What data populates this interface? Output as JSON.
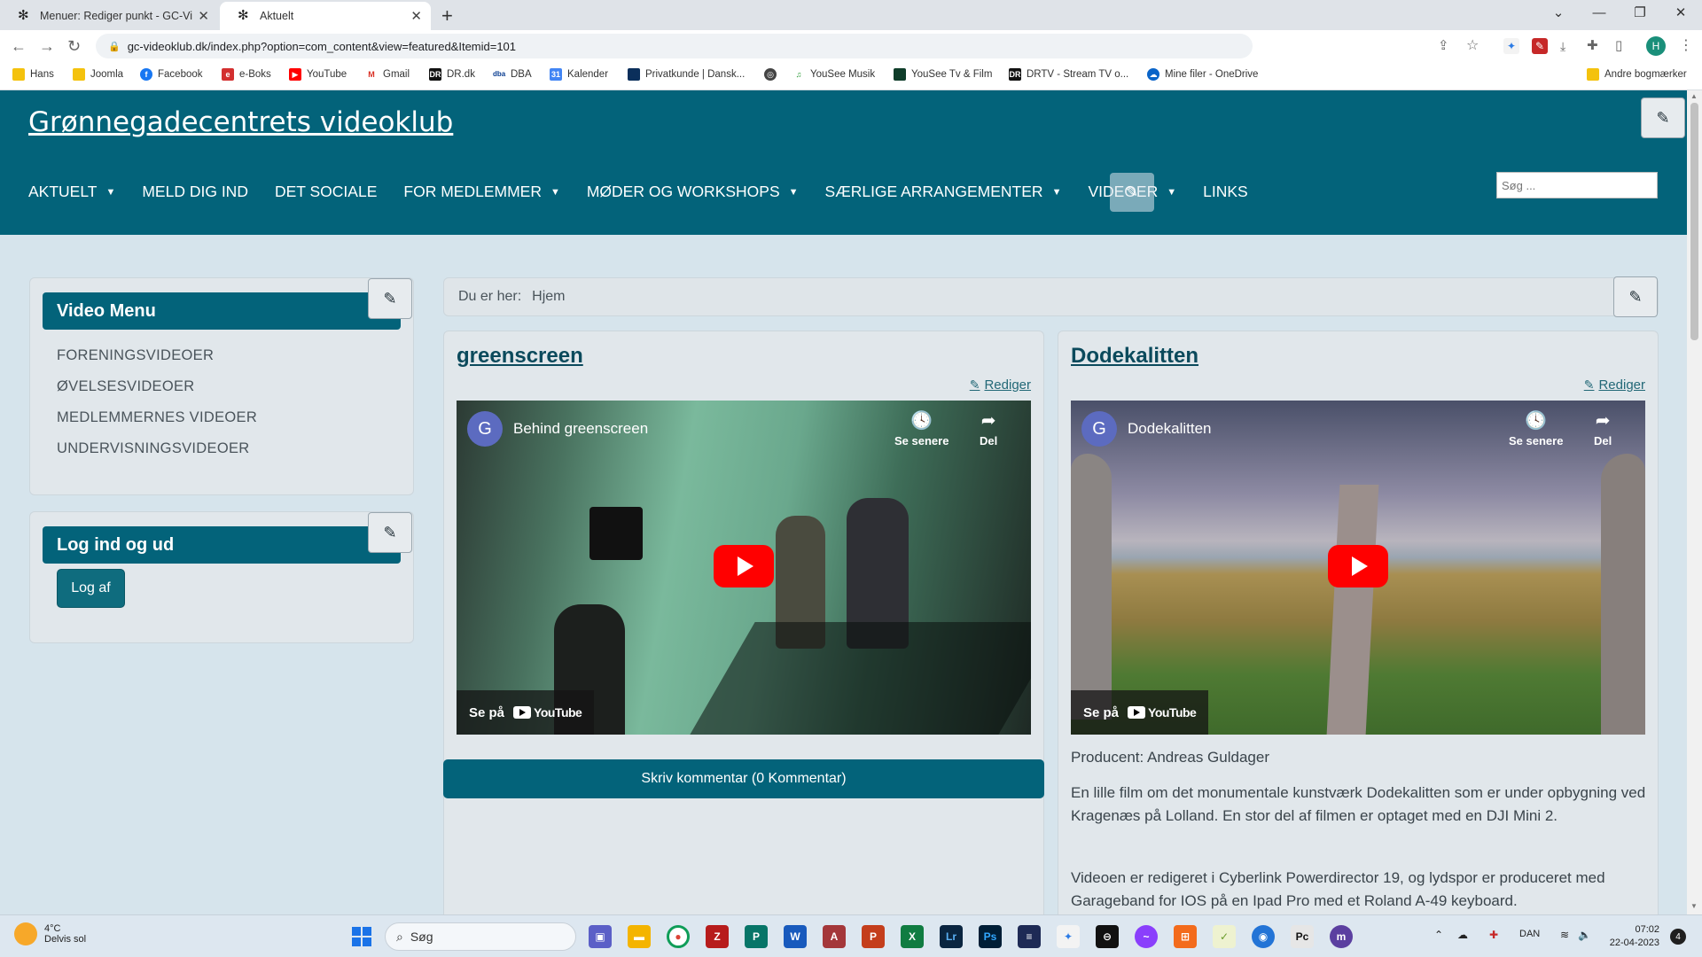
{
  "browser": {
    "tabs": [
      {
        "title": "Menuer: Rediger punkt - GC-Videoklub",
        "active": false
      },
      {
        "title": "Aktuelt",
        "active": true
      }
    ],
    "url": "gc-videoklub.dk/index.php?option=com_content&view=featured&Itemid=101",
    "profile_initial": "H",
    "bookmarks": [
      "Hans",
      "Joomla",
      "Facebook",
      "e-Boks",
      "YouTube",
      "Gmail",
      "DR.dk",
      "DBA",
      "Kalender",
      "Privatkunde | Dansk...",
      "YouSee Musik",
      "YouSee Tv & Film",
      "DRTV - Stream TV o...",
      "Mine filer - OneDrive"
    ],
    "other_bookmarks": "Andre bogmærker"
  },
  "site": {
    "title": "Grønnegadecentrets videoklub",
    "nav": [
      {
        "label": "AKTUELT",
        "dropdown": true
      },
      {
        "label": "MELD DIG IND",
        "dropdown": false
      },
      {
        "label": "DET SOCIALE",
        "dropdown": false
      },
      {
        "label": "FOR MEDLEMMER",
        "dropdown": true
      },
      {
        "label": "MØDER OG WORKSHOPS",
        "dropdown": true
      },
      {
        "label": "SÆRLIGE ARRANGEMENTER",
        "dropdown": true
      },
      {
        "label": "VIDEOER",
        "dropdown": true
      },
      {
        "label": "LINKS",
        "dropdown": false
      }
    ],
    "search_placeholder": "Søg ..."
  },
  "sidebar": {
    "video_menu": {
      "title": "Video Menu",
      "items": [
        "FORENINGSVIDEOER",
        "ØVELSESVIDEOER",
        "MEDLEMMERNES VIDEOER",
        "UNDERVISNINGSVIDEOER"
      ]
    },
    "login": {
      "title": "Log ind og ud",
      "button": "Log af"
    }
  },
  "breadcrumb": {
    "label": "Du er her:",
    "home": "Hjem"
  },
  "articles": [
    {
      "title": "greenscreen",
      "edit": "Rediger",
      "video": {
        "channel_initial": "G",
        "title": "Behind greenscreen",
        "watch_later": "Se senere",
        "share": "Del",
        "watch_on": "Se på",
        "platform": "YouTube"
      },
      "comment_button": "Skriv kommentar (0 Kommentar)"
    },
    {
      "title": "Dodekalitten",
      "edit": "Rediger",
      "video": {
        "channel_initial": "G",
        "title": "Dodekalitten",
        "watch_later": "Se senere",
        "share": "Del",
        "watch_on": "Se på",
        "platform": "YouTube"
      },
      "paragraphs": [
        "Producent: Andreas Guldager",
        "En lille film om det monumentale kunstværk Dodekalitten som er under opbygning ved Kragenæs på Lolland. En stor del af filmen er optaget med en DJI Mini 2.",
        "Videoen er redigeret i Cyberlink Powerdirector 19, og lydspor er produceret med Garageband for IOS på en Ipad Pro med et Roland A-49 keyboard."
      ]
    }
  ],
  "taskbar": {
    "weather_temp": "4°C",
    "weather_desc": "Delvis sol",
    "search": "Søg",
    "language": "DAN",
    "time": "07:02",
    "date": "22-04-2023",
    "notifications": "4"
  },
  "colors": {
    "header": "#03637a",
    "page_bg": "#d6e4ec",
    "youtube_red": "#ff0000"
  }
}
